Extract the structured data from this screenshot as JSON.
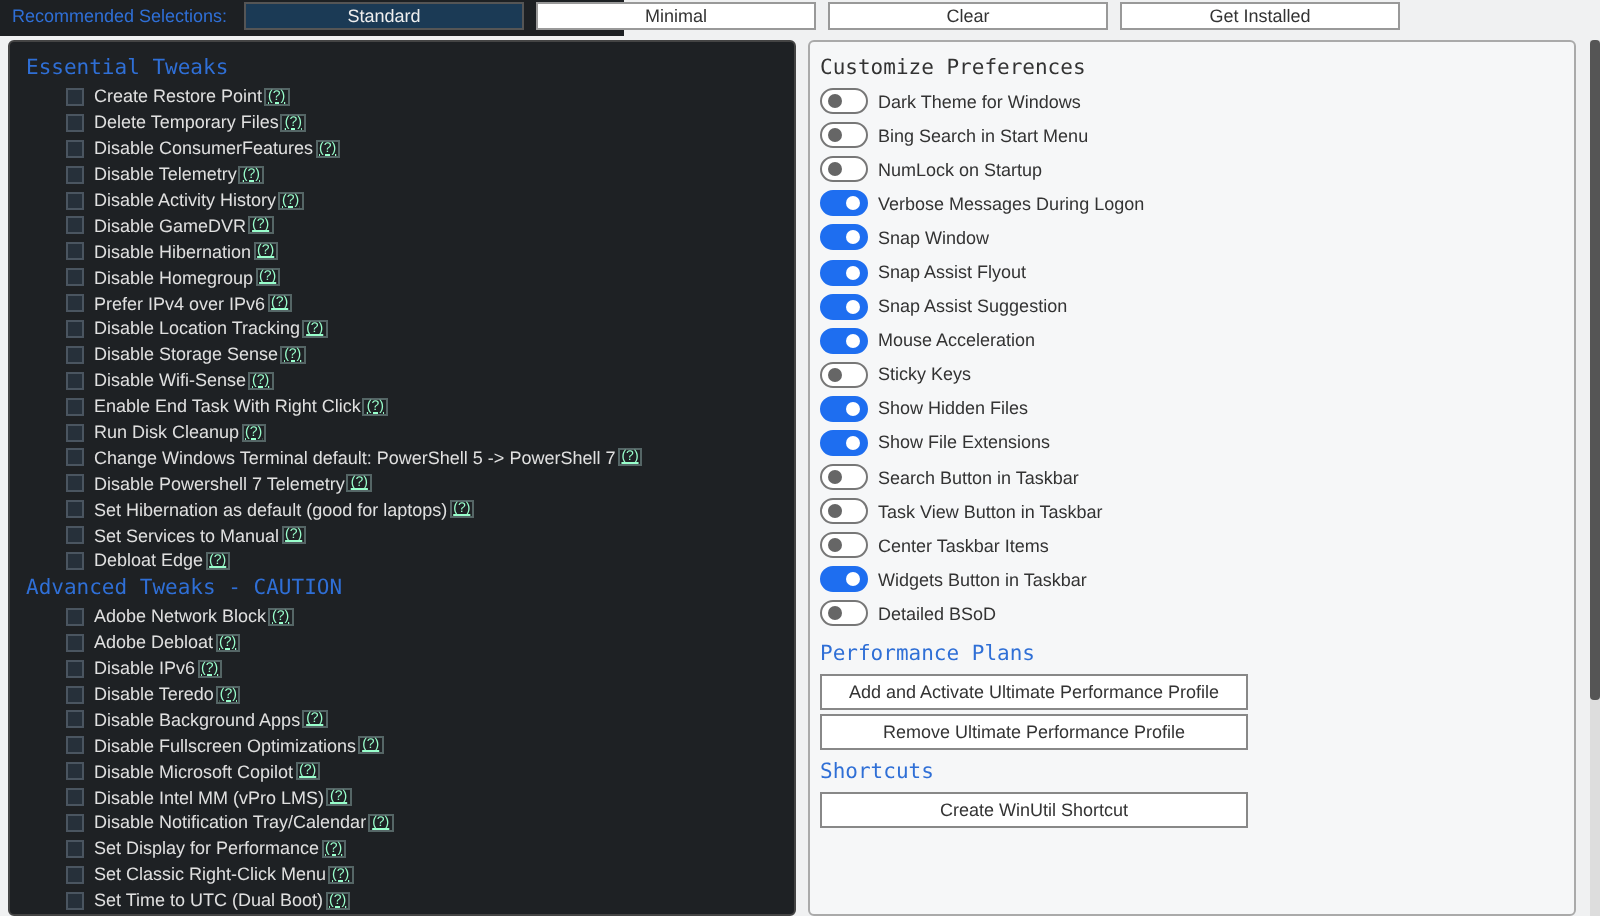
{
  "top_bar": {
    "label": "Recommended Selections:",
    "buttons": [
      {
        "label": "Standard",
        "selected": true
      },
      {
        "label": "Minimal",
        "selected": false
      },
      {
        "label": "Clear",
        "selected": false
      },
      {
        "label": "Get Installed",
        "selected": false
      }
    ]
  },
  "tweaks": {
    "sections": [
      {
        "title": "Essential Tweaks",
        "items": [
          {
            "label": "Create Restore Point",
            "help": "(?)",
            "checked": false
          },
          {
            "label": "Delete Temporary Files",
            "help": "(?)",
            "checked": false
          },
          {
            "label": "Disable ConsumerFeatures",
            "help": "(?)",
            "checked": false
          },
          {
            "label": "Disable Telemetry",
            "help": "(?)",
            "checked": false
          },
          {
            "label": "Disable Activity History",
            "help": "(?)",
            "checked": false
          },
          {
            "label": "Disable GameDVR",
            "help": "(?)",
            "checked": false
          },
          {
            "label": "Disable Hibernation",
            "help": "(?)",
            "checked": false
          },
          {
            "label": "Disable Homegroup",
            "help": "(?)",
            "checked": false
          },
          {
            "label": "Prefer IPv4 over IPv6",
            "help": "(?)",
            "checked": false
          },
          {
            "label": "Disable Location Tracking",
            "help": "(?)",
            "checked": false
          },
          {
            "label": "Disable Storage Sense",
            "help": "(?)",
            "checked": false
          },
          {
            "label": "Disable Wifi-Sense",
            "help": "(?)",
            "checked": false
          },
          {
            "label": "Enable End Task With Right Click",
            "help": "(?)",
            "checked": false
          },
          {
            "label": "Run Disk Cleanup",
            "help": "(?)",
            "checked": false
          },
          {
            "label": "Change Windows Terminal default: PowerShell 5 -> PowerShell 7",
            "help": "(?)",
            "checked": false
          },
          {
            "label": "Disable Powershell 7 Telemetry",
            "help": "(?)",
            "checked": false
          },
          {
            "label": "Set Hibernation as default (good for laptops)",
            "help": "(?)",
            "checked": false
          },
          {
            "label": "Set Services to Manual",
            "help": "(?)",
            "checked": false
          },
          {
            "label": "Debloat Edge",
            "help": "(?)",
            "checked": false
          }
        ]
      },
      {
        "title": "Advanced Tweaks - CAUTION",
        "items": [
          {
            "label": "Adobe Network Block",
            "help": "(?)",
            "checked": false
          },
          {
            "label": "Adobe Debloat",
            "help": "(?)",
            "checked": false
          },
          {
            "label": "Disable IPv6",
            "help": "(?)",
            "checked": false
          },
          {
            "label": "Disable Teredo",
            "help": "(?)",
            "checked": false
          },
          {
            "label": "Disable Background Apps",
            "help": "(?)",
            "checked": false
          },
          {
            "label": "Disable Fullscreen Optimizations",
            "help": "(?)",
            "checked": false
          },
          {
            "label": "Disable Microsoft Copilot",
            "help": "(?)",
            "checked": false
          },
          {
            "label": "Disable Intel MM (vPro LMS)",
            "help": "(?)",
            "checked": false
          },
          {
            "label": "Disable Notification Tray/Calendar",
            "help": "(?)",
            "checked": false
          },
          {
            "label": "Set Display for Performance",
            "help": "(?)",
            "checked": false
          },
          {
            "label": "Set Classic Right-Click Menu ",
            "help": "(?)",
            "checked": false
          },
          {
            "label": "Set Time to UTC (Dual Boot)",
            "help": "(?)",
            "checked": false
          }
        ]
      }
    ]
  },
  "preferences": {
    "title": "Customize Preferences",
    "toggles": [
      {
        "label": "Dark Theme for Windows",
        "on": false
      },
      {
        "label": "Bing Search in Start Menu",
        "on": false
      },
      {
        "label": "NumLock on Startup",
        "on": false
      },
      {
        "label": "Verbose Messages During Logon",
        "on": true
      },
      {
        "label": "Snap Window",
        "on": true
      },
      {
        "label": "Snap Assist Flyout",
        "on": true
      },
      {
        "label": "Snap Assist Suggestion",
        "on": true
      },
      {
        "label": "Mouse Acceleration",
        "on": true
      },
      {
        "label": "Sticky Keys",
        "on": false
      },
      {
        "label": "Show Hidden Files",
        "on": true
      },
      {
        "label": "Show File Extensions",
        "on": true
      },
      {
        "label": "Search Button in Taskbar",
        "on": false
      },
      {
        "label": "Task View Button in Taskbar",
        "on": false
      },
      {
        "label": "Center Taskbar Items",
        "on": false
      },
      {
        "label": "Widgets Button in Taskbar",
        "on": true
      },
      {
        "label": "Detailed BSoD",
        "on": false
      }
    ],
    "groups": [
      {
        "title": "Performance Plans",
        "buttons": [
          "Add and Activate Ultimate Performance Profile",
          "Remove Ultimate Performance Profile"
        ]
      },
      {
        "title": "Shortcuts",
        "buttons": [
          "Create WinUtil Shortcut"
        ]
      }
    ]
  }
}
